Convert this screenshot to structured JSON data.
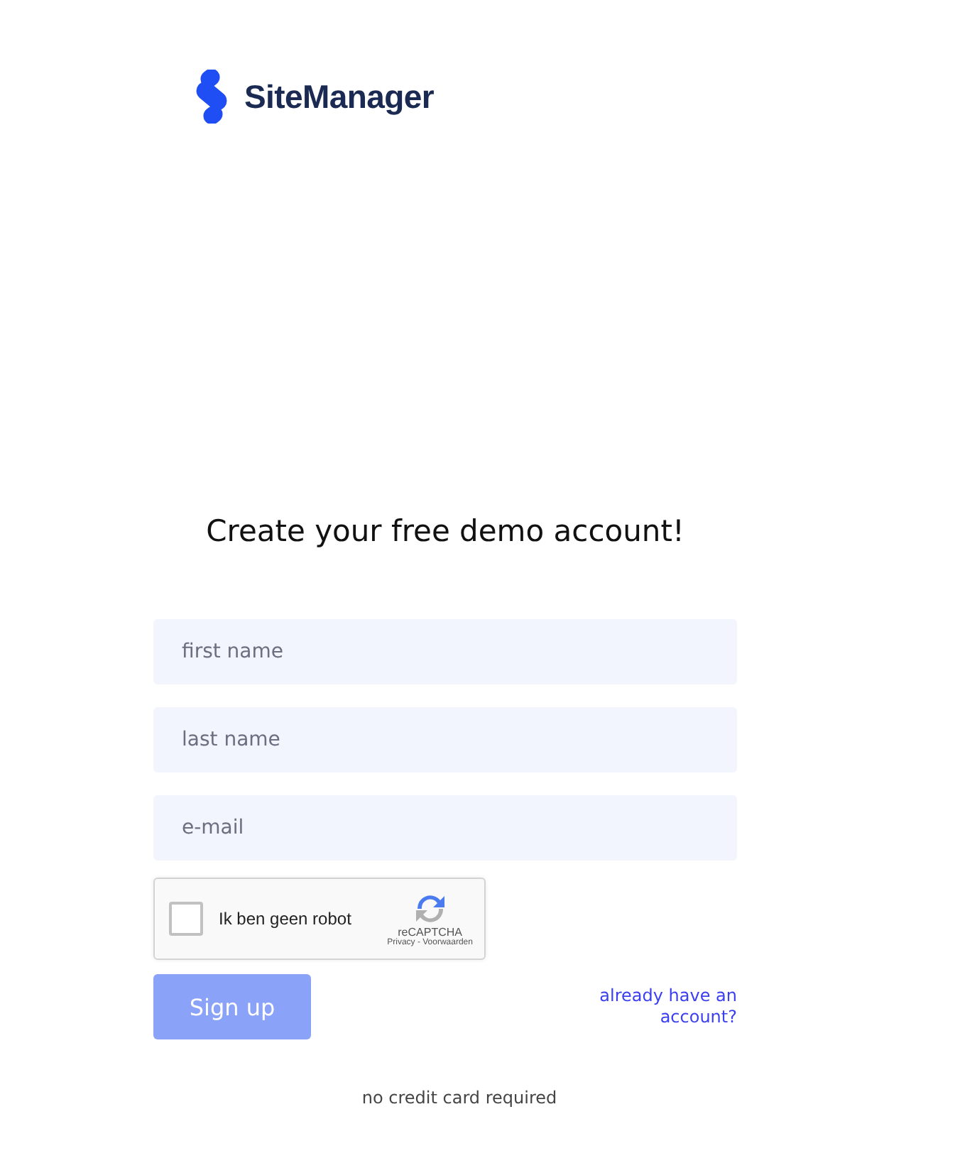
{
  "brand": {
    "name": "SiteManager"
  },
  "heading": "Create your free demo account!",
  "fields": [
    {
      "placeholder": "first name"
    },
    {
      "placeholder": "last name"
    },
    {
      "placeholder": "e-mail"
    }
  ],
  "captcha": {
    "label": "Ik ben geen robot",
    "checked": false,
    "brand": "reCAPTCHA",
    "links": "Privacy - Voorwaarden"
  },
  "signup": {
    "label": "Sign up",
    "disabled": true
  },
  "login_link": "already have an account?",
  "note": "no credit card required"
}
